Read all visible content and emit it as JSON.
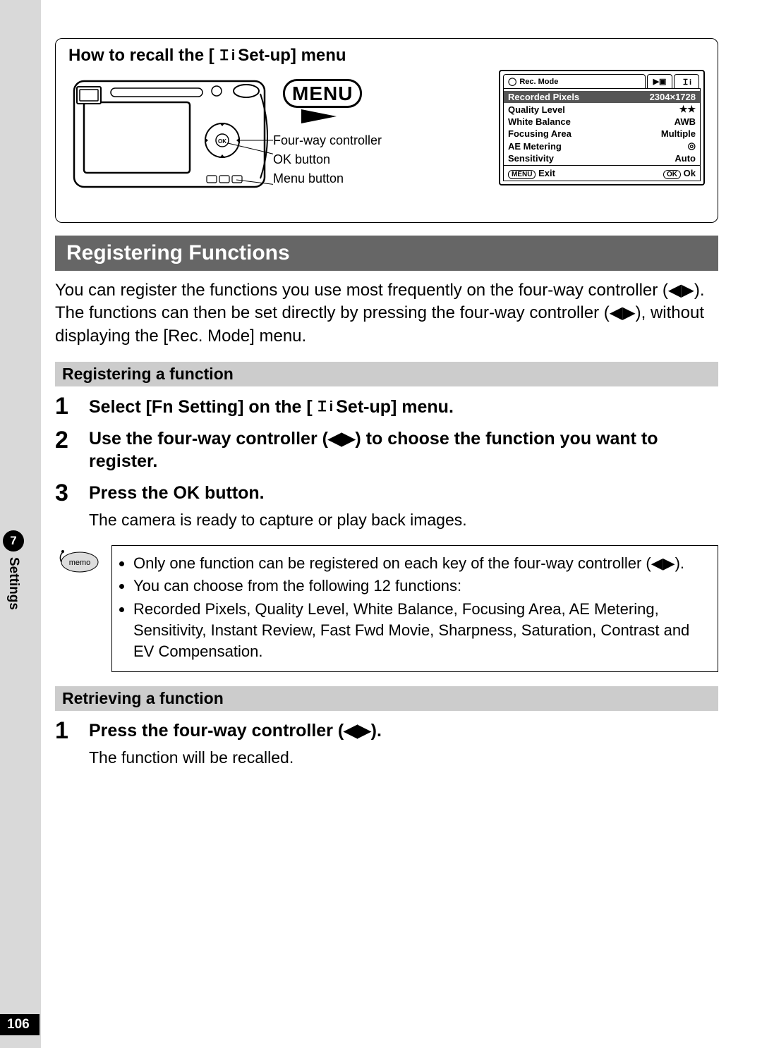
{
  "recall": {
    "title_left": "How to recall the [",
    "title_right": " Set-up] menu",
    "menu_badge": "MENU",
    "callouts": {
      "four_way": "Four-way controller",
      "ok_button": "OK button",
      "menu_button": "Menu button"
    },
    "lcd": {
      "tab_rec": "Rec. Mode",
      "tab_play_glyph": "▶",
      "tab_setup_glyph": "Ｉi",
      "rows": [
        {
          "label": "Recorded Pixels",
          "value": "2304×1728",
          "hl": true
        },
        {
          "label": "Quality Level",
          "value": "★★"
        },
        {
          "label": "White Balance",
          "value": "AWB"
        },
        {
          "label": "Focusing Area",
          "value": "Multiple"
        },
        {
          "label": "AE Metering",
          "value": "◎"
        },
        {
          "label": "Sensitivity",
          "value": "Auto"
        }
      ],
      "footer_exit": "Exit",
      "footer_ok": "Ok",
      "menu_label": "MENU",
      "ok_label": "OK"
    }
  },
  "section_title": "Registering Functions",
  "intro": "You can register the functions you use most frequently on the four-way controller (◀▶). The functions can then be set directly by pressing the four-way controller (◀▶), without displaying the [Rec. Mode] menu.",
  "sub1": "Registering a function",
  "steps1": {
    "1": {
      "text_left": "Select [Fn Setting] on the [",
      "text_right": " Set-up] menu."
    },
    "2": "Use the four-way controller (◀▶) to choose the function you want to register.",
    "3": "Press the OK button.",
    "3_note": "The camera is ready to capture or play back images."
  },
  "memo": {
    "label": "memo",
    "b1": "Only one function can be registered on each key of the four-way controller (◀▶).",
    "b2": "You can choose from the following 12 functions:",
    "b3": "Recorded Pixels, Quality Level, White Balance, Focusing Area, AE Metering, Sensitivity, Instant Review, Fast Fwd Movie, Sharpness, Saturation, Contrast and EV Compensation."
  },
  "sub2": "Retrieving a function",
  "steps2": {
    "1": "Press the four-way controller (◀▶).",
    "1_note": "The function will be recalled."
  },
  "sidebar": {
    "chapter_num": "7",
    "chapter_label": "Settings"
  },
  "page_number": "106"
}
